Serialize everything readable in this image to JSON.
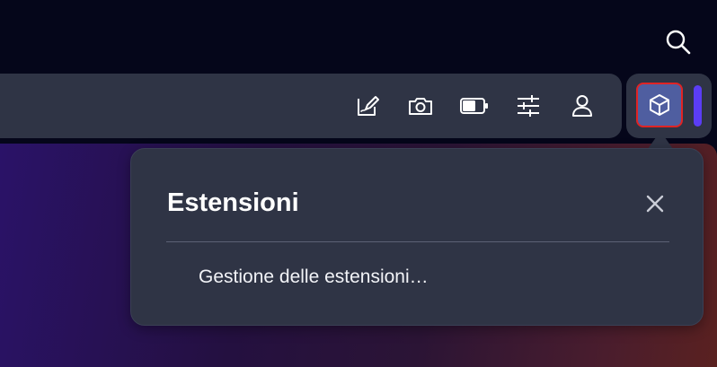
{
  "topbar": {
    "search_icon": "search-icon"
  },
  "toolbar": {
    "icons": [
      "pen-sign-icon",
      "camera-icon",
      "battery-icon",
      "sliders-icon",
      "profile-icon"
    ]
  },
  "extensions_button": {
    "icon": "cube-icon",
    "highlight_color": "#e02424",
    "bg_color": "#4f5ea0"
  },
  "popup": {
    "title": "Estensioni",
    "close_icon": "close-icon",
    "item_label": "Gestione delle estensioni…"
  },
  "colors": {
    "surface": "#2f3445",
    "accent": "#5b3df5"
  }
}
